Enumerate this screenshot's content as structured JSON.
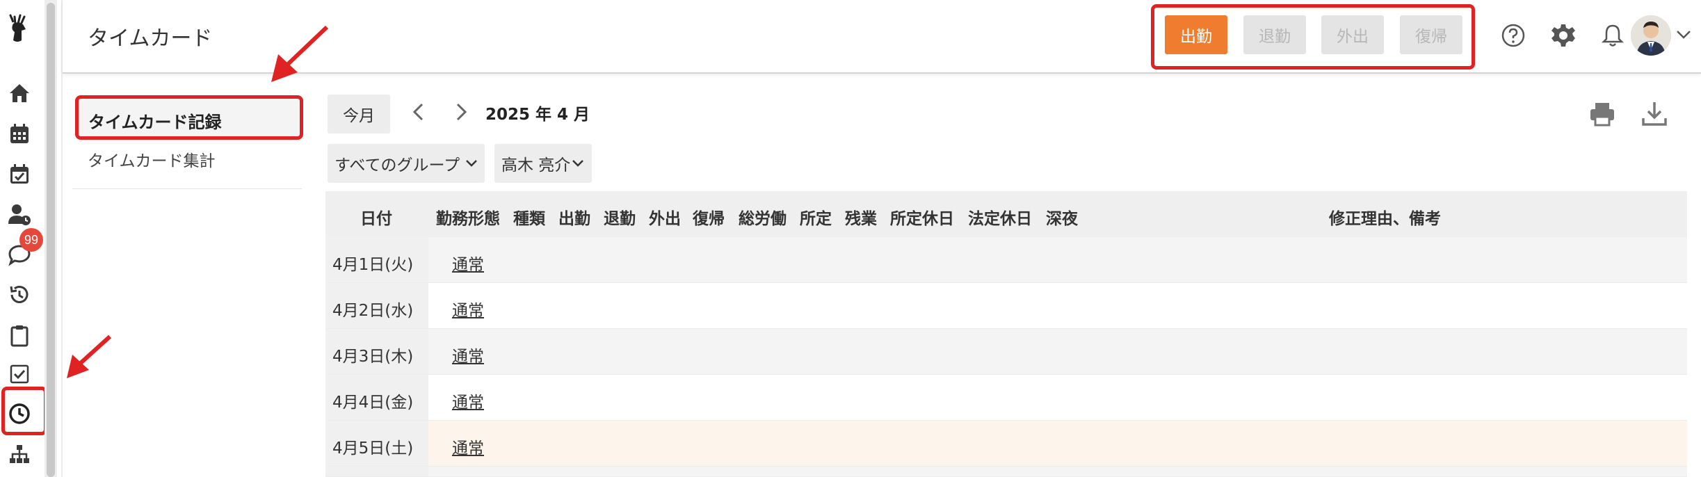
{
  "header": {
    "title": "タイムカード",
    "punch_buttons": [
      "出勤",
      "退勤",
      "外出",
      "復帰"
    ],
    "icons": [
      "help-icon",
      "gear-icon",
      "bell-icon"
    ]
  },
  "rail": {
    "icons": [
      "home-icon",
      "calendar-icon",
      "calendar-check-icon",
      "user-clock-icon",
      "chat-icon",
      "history-icon",
      "clipboard-icon",
      "checkbox-icon",
      "clock-icon",
      "org-chart-icon"
    ],
    "chat_badge": "99"
  },
  "subnav": {
    "active": "タイムカード記録",
    "item": "タイムカード集計"
  },
  "toolbar": {
    "today": "今月",
    "month": "2025 年 4 月",
    "group_select": "すべてのグループ",
    "user_select": "高木 亮介"
  },
  "table": {
    "headers": [
      "日付",
      "勤務形態",
      "種類",
      "出勤",
      "退勤",
      "外出",
      "復帰",
      "総労働",
      "所定",
      "残業",
      "所定休日",
      "法定休日",
      "深夜",
      "修正理由、備考"
    ],
    "rows": [
      {
        "date": "4月1日(火)",
        "type": "通常"
      },
      {
        "date": "4月2日(水)",
        "type": "通常"
      },
      {
        "date": "4月3日(木)",
        "type": "通常"
      },
      {
        "date": "4月4日(金)",
        "type": "通常"
      },
      {
        "date": "4月5日(土)",
        "type": "通常"
      }
    ]
  },
  "colors": {
    "accent": "#f07d2f",
    "highlight": "#e12222",
    "saturday_row": "#fdf4ec"
  }
}
